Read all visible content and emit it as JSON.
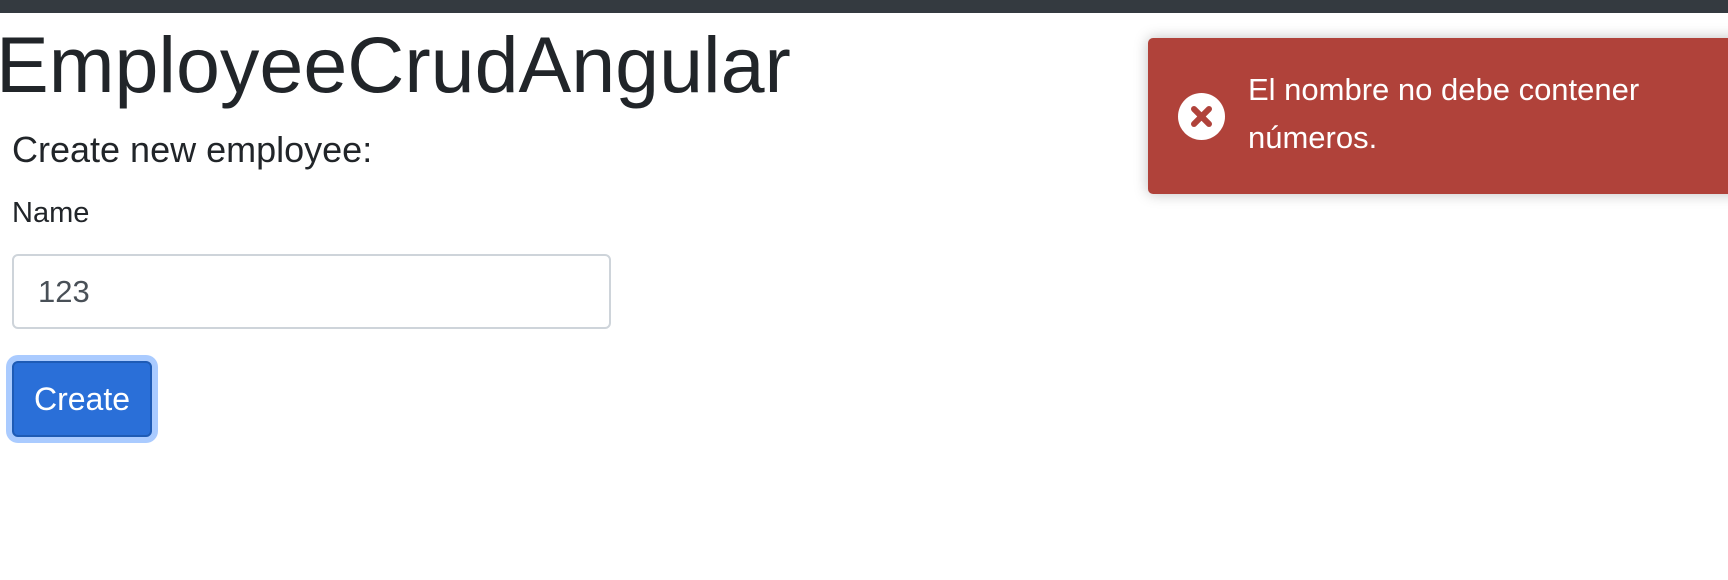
{
  "app": {
    "title": "EmployeeCrudAngular"
  },
  "form": {
    "heading": "Create new employee:",
    "name_label": "Name",
    "name_value": "123",
    "create_label": "Create"
  },
  "toast": {
    "type": "error",
    "icon": "error-circle-x-icon",
    "message": "El nombre no debe contener números."
  },
  "colors": {
    "navbar": "#343a40",
    "primary_button": "#2a6fd8",
    "error_toast": "#b0423a"
  }
}
